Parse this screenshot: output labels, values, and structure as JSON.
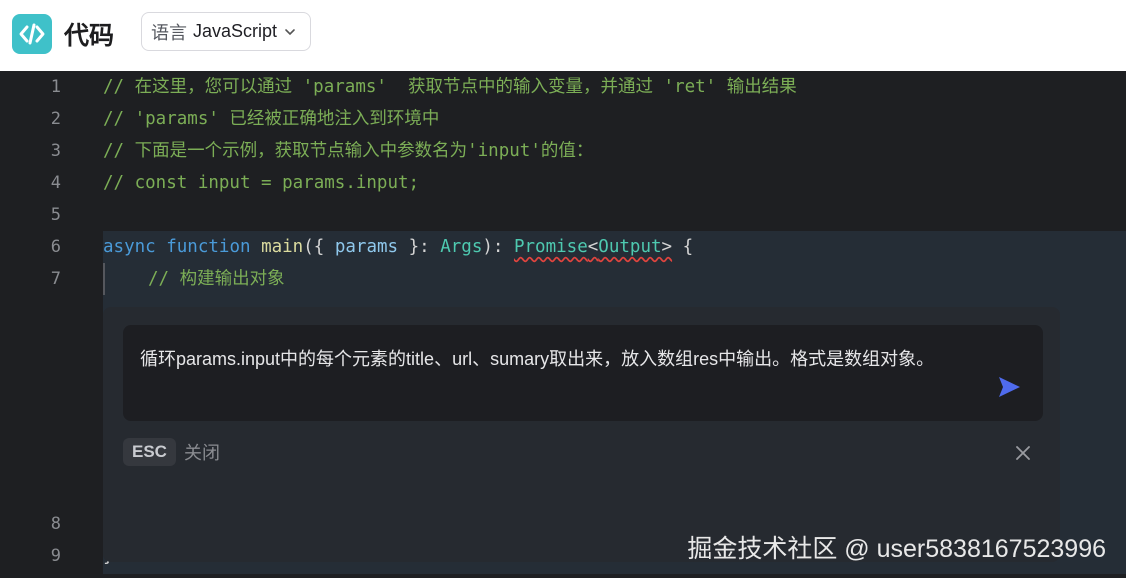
{
  "header": {
    "title": "代码",
    "language_prefix": "语言",
    "language_value": "JavaScript"
  },
  "editor": {
    "line_numbers": [
      "1",
      "2",
      "3",
      "4",
      "5",
      "6",
      "7",
      "8",
      "9"
    ],
    "lines": {
      "l1": "// 在这里，您可以通过 'params'  获取节点中的输入变量，并通过 'ret' 输出结果",
      "l2": "// 'params' 已经被正确地注入到环境中",
      "l3": "// 下面是一个示例，获取节点输入中参数名为'input'的值：",
      "l4": "// const input = params.input;",
      "l6": {
        "async": "async",
        "function": "function",
        "name": "main",
        "open": "({ ",
        "param": "params",
        "mid": " }: ",
        "args": "Args",
        "close": "): ",
        "promise": "Promise",
        "lt": "<",
        "output": "Output",
        "gt": ">",
        "brace": " {"
      },
      "l7": "// 构建输出对象",
      "l9": "}"
    }
  },
  "prompt": {
    "text": "循环params.input中的每个元素的title、url、sumary取出来，放入数组res中输出。格式是数组对象。",
    "esc_key": "ESC",
    "close_label": "关闭"
  },
  "watermark": "掘金技术社区 @ user5838167523996",
  "colors": {
    "accent_logo": "#3fc1c9",
    "send_icon": "#4f6bed",
    "editor_bg": "#1e1f22"
  },
  "icons": [
    "code-logo-icon",
    "chevron-down-icon",
    "send-icon",
    "close-icon"
  ]
}
